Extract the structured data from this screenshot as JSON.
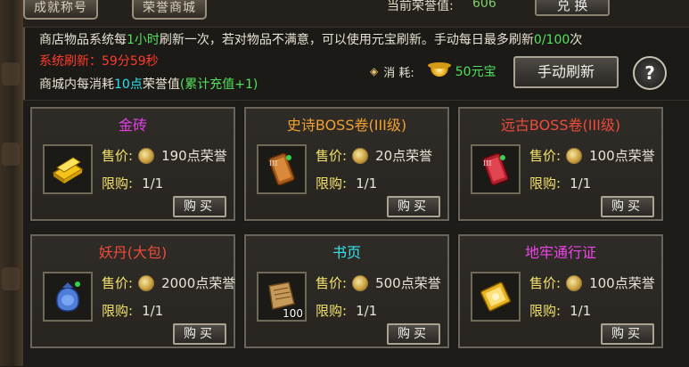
{
  "tabs": [
    "成就称号",
    "荣誉商城"
  ],
  "honor": {
    "label": "当前荣誉值:",
    "value": "606"
  },
  "exchange_label": "兑 换",
  "info": {
    "line1_a": "商店物品系统每",
    "line1_b": "1小时",
    "line1_c": "刷新一次，若对物品不满意，可以使用元宝刷新。手动每日最多刷新",
    "line1_d": "0/100",
    "line1_e": "次",
    "countdown": "系统刷新：59分59秒",
    "line3_a": "商城内每消耗",
    "line3_b": "10点",
    "line3_c": "荣誉值",
    "line3_d": "(累计充值+1)"
  },
  "cost": {
    "symbol": "◈",
    "label": "消 耗:",
    "amount": "50元宝"
  },
  "refresh_label": "手动刷新",
  "help_label": "?",
  "buy_label": "购买",
  "price_label": "售价:",
  "limit_label": "限购:",
  "items": [
    {
      "name": "金砖",
      "name_color": "#e040e6",
      "price": "190点荣誉",
      "limit": "1/1",
      "icon": "gold-brick-icon",
      "stack": ""
    },
    {
      "name": "史诗BOSS卷(III级)",
      "name_color": "#f0a030",
      "price": "20点荣誉",
      "limit": "1/1",
      "icon": "boss-scroll-icon",
      "stack": ""
    },
    {
      "name": "远古BOSS卷(III级)",
      "name_color": "#f04a3a",
      "price": "100点荣誉",
      "limit": "1/1",
      "icon": "red-boss-scroll-icon",
      "stack": ""
    },
    {
      "name": "妖丹(大包)",
      "name_color": "#f04a3a",
      "price": "2000点荣誉",
      "limit": "1/1",
      "icon": "pill-bag-icon",
      "stack": ""
    },
    {
      "name": "书页",
      "name_color": "#38e4ef",
      "price": "500点荣誉",
      "limit": "1/1",
      "icon": "book-page-icon",
      "stack": "100"
    },
    {
      "name": "地牢通行证",
      "name_color": "#ee44e8",
      "price": "100点荣誉",
      "limit": "1/1",
      "icon": "dungeon-pass-icon",
      "stack": ""
    }
  ]
}
